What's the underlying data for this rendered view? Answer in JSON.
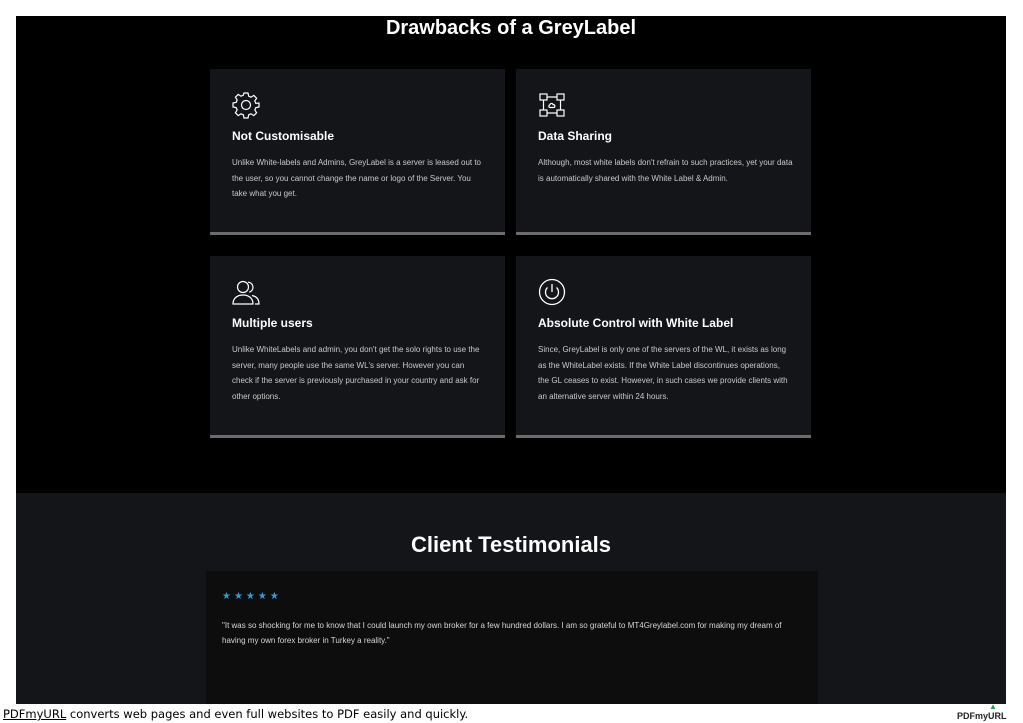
{
  "drawbacks": {
    "title": "Drawbacks of a GreyLabel",
    "cards": [
      {
        "icon": "gear-icon",
        "title": "Not Customisable",
        "description": "Unlike White-labels and Admins, GreyLabel is a server is leased out to the user, so you cannot change the name or logo of the Server. You take what you get."
      },
      {
        "icon": "network-sharing-icon",
        "title": "Data Sharing",
        "description": "Although, most white labels don't refrain to such practices, yet your data is automatically shared with the White Label & Admin."
      },
      {
        "icon": "users-icon",
        "title": "Multiple users",
        "description": "Unlike WhiteLabels and admin, you don't get the solo rights to use the server, many people use the same WL's server. However you can check if the server is previously purchased in your country and ask for other options."
      },
      {
        "icon": "power-icon",
        "title": "Absolute Control with White Label",
        "description": "Since, GreyLabel is only one of the servers of the WL, it exists as long as the WhiteLabel exists. If the White Label discontinues operations, the GL ceases to exist. However, in such cases we provide clients with an alternative server within 24 hours."
      }
    ]
  },
  "testimonials": {
    "title": "Client Testimonials",
    "rating": 5,
    "stars": "★★★★★",
    "quote": "\"It was so shocking for me to know that I could launch my own broker for a few hundred dollars. I am so grateful to MT4Greylabel.com for making my dream of having my own forex broker in Turkey a reality.\""
  },
  "footer": {
    "link": "PDFmyURL",
    "text": " converts web pages and even full websites to PDF easily and quickly.",
    "logo": "PDFmyURL"
  },
  "colors": {
    "background": "#000000",
    "card": "#141518",
    "card_border": "#6c6c6c",
    "star": "#2a9fd6"
  }
}
